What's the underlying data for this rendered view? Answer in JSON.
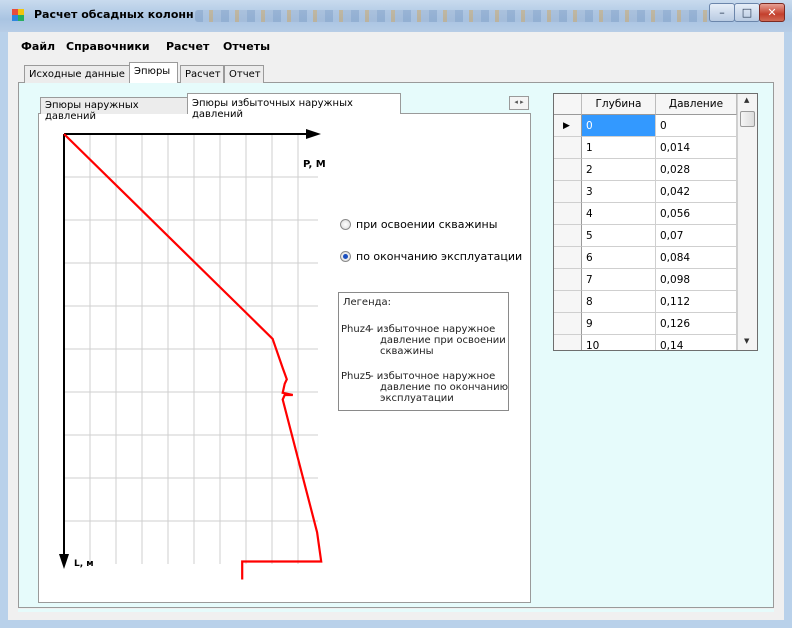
{
  "window": {
    "title": "Расчет обсадных колонн"
  },
  "menu": [
    "Файл",
    "Справочники",
    "Расчет",
    "Отчеты"
  ],
  "outer_tabs": [
    {
      "label": "Исходные данные",
      "selected": false
    },
    {
      "label": "Эпюры",
      "selected": true
    },
    {
      "label": "Расчет",
      "selected": false
    },
    {
      "label": "Отчет",
      "selected": false
    }
  ],
  "inner_tabs": [
    {
      "label": "Эпюры наружных давлений",
      "selected": false
    },
    {
      "label": "Эпюры избыточных наружных давлений",
      "selected": true
    }
  ],
  "chart": {
    "x_axis_label": "P, М",
    "y_axis_label": "L, м",
    "line_color": "#ff0000",
    "chart_data": {
      "type": "line",
      "xlabel": "P, М",
      "ylabel": "L, м",
      "grid": true,
      "series": [
        {
          "points": [
            [
              0,
              0
            ],
            [
              0.515,
              0.455
            ],
            [
              0.54,
              0.52
            ],
            [
              0.55,
              0.545
            ],
            [
              0.545,
              0.555
            ],
            [
              0.54,
              0.575
            ],
            [
              0.565,
              0.58
            ],
            [
              0.545,
              0.58
            ],
            [
              0.54,
              0.59
            ],
            [
              0.625,
              0.885
            ],
            [
              0.635,
              0.95
            ],
            [
              0.44,
              0.95
            ],
            [
              0.44,
              0.99
            ]
          ]
        }
      ]
    }
  },
  "radios": [
    {
      "label": "при освоении скважины",
      "checked": false
    },
    {
      "label": "по окончанию эксплуатации",
      "checked": true
    }
  ],
  "legend": {
    "title": "Легенда:",
    "items": [
      {
        "code": "Phuz4",
        "lines": [
          "- избыточное наружное",
          "давление при освоении",
          "скважины"
        ]
      },
      {
        "code": "Phuz5",
        "lines": [
          "- избыточное наружное",
          "давление по окончанию",
          "эксплуатации"
        ]
      }
    ]
  },
  "table": {
    "columns": [
      "Глубина",
      "Давление"
    ],
    "rows": [
      [
        "0",
        "0"
      ],
      [
        "1",
        "0,014"
      ],
      [
        "2",
        "0,028"
      ],
      [
        "3",
        "0,042"
      ],
      [
        "4",
        "0,056"
      ],
      [
        "5",
        "0,07"
      ],
      [
        "6",
        "0,084"
      ],
      [
        "7",
        "0,098"
      ],
      [
        "8",
        "0,112"
      ],
      [
        "9",
        "0,126"
      ],
      [
        "10",
        "0,14"
      ]
    ],
    "selected_row": 0
  }
}
